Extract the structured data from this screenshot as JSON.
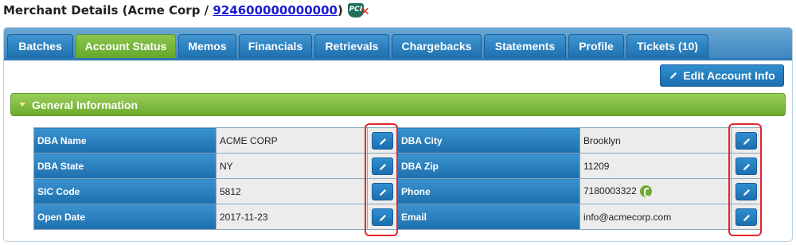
{
  "header": {
    "title_prefix": "Merchant Details (",
    "merchant_name": "Acme Corp",
    "separator": " / ",
    "merchant_id": "924600000000000",
    "title_suffix": ")",
    "pci_badge_text": "PCI",
    "pci_status_mark": "✕",
    "pci_status_color": "#e02020"
  },
  "tabs": [
    {
      "label": "Batches"
    },
    {
      "label": "Account Status",
      "active": true
    },
    {
      "label": "Memos"
    },
    {
      "label": "Financials"
    },
    {
      "label": "Retrievals"
    },
    {
      "label": "Chargebacks"
    },
    {
      "label": "Statements"
    },
    {
      "label": "Profile"
    },
    {
      "label": "Tickets (10)"
    }
  ],
  "toolbar": {
    "edit_account_info_label": "Edit Account Info",
    "edit_icon": "pencil-icon"
  },
  "section": {
    "title": "General Information",
    "collapse_icon": "triangle-down-icon"
  },
  "general_info": {
    "rows": [
      {
        "left_label": "DBA Name",
        "left_value": "ACME CORP",
        "right_label": "DBA City",
        "right_value": "Brooklyn"
      },
      {
        "left_label": "DBA State",
        "left_value": "NY",
        "right_label": "DBA Zip",
        "right_value": "11209"
      },
      {
        "left_label": "SIC Code",
        "left_value": "5812",
        "right_label": "Phone",
        "right_value": "7180003322",
        "right_icon": "phone-icon"
      },
      {
        "left_label": "Open Date",
        "left_value": "2017-11-23",
        "right_label": "Email",
        "right_value": "info@acmecorp.com"
      }
    ]
  },
  "colors": {
    "tab_blue": "#2f8fd0",
    "tab_active_green": "#7fbe43",
    "section_green": "#7fbe43",
    "label_cell_blue": "#2b82c2",
    "value_cell_gray": "#ececec",
    "highlight_red": "#e0282f"
  }
}
